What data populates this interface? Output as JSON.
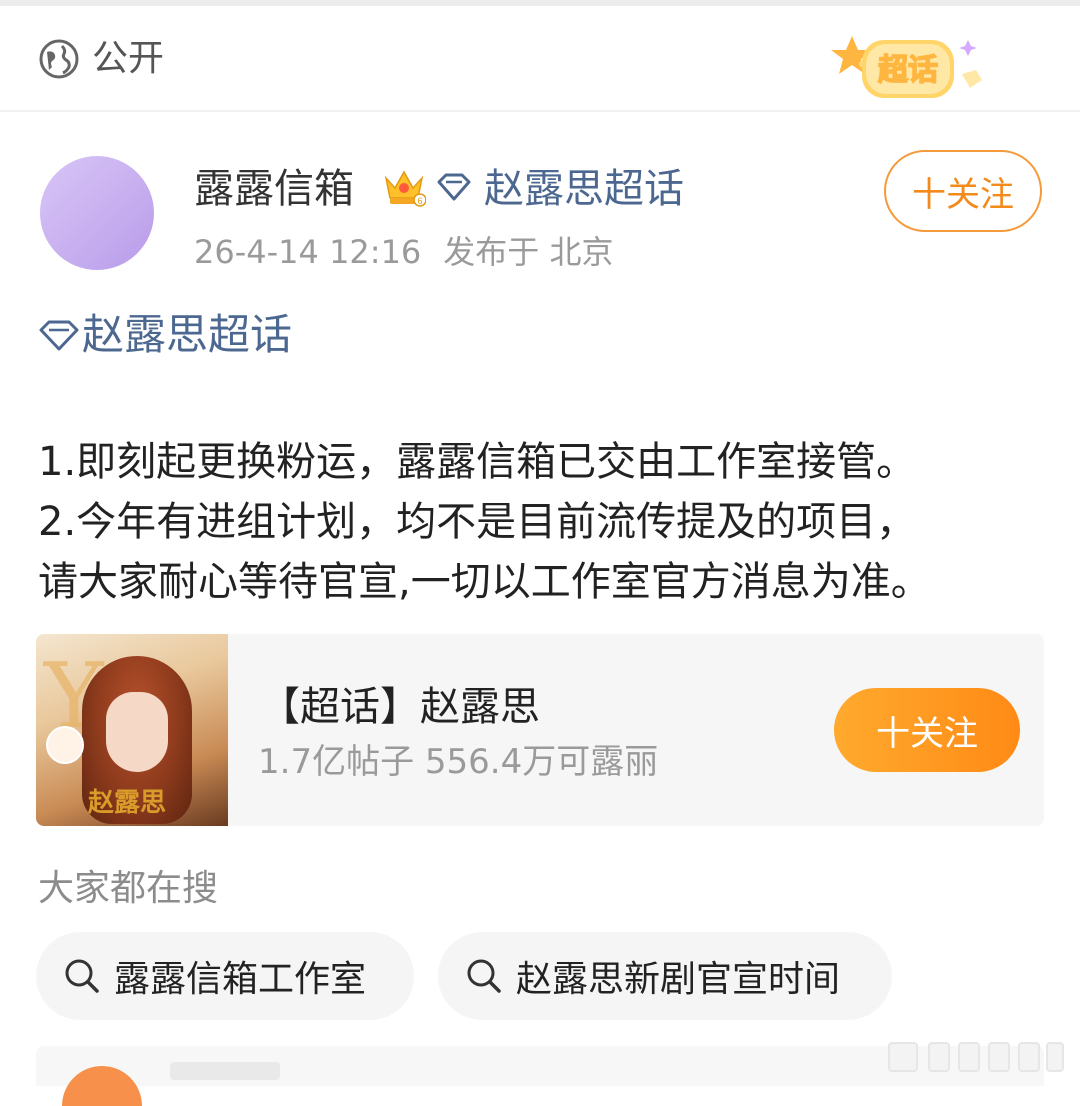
{
  "topbar": {
    "visibility_label": "公开",
    "badge_label": "超话"
  },
  "post": {
    "author_name": "露露信箱",
    "author_topic": "赵露思超话",
    "follow_label": "十关注",
    "timestamp": "26-4-14 12:16",
    "location": "发布于 北京",
    "topic_tag": "赵露思超话",
    "body_lines": [
      "1.即刻起更换粉运，露露信箱已交由工作室接管。",
      "2.今年有进组计划，均不是目前流传提及的项目，",
      "请大家耐心等待官宣,一切以工作室官方消息为准。"
    ]
  },
  "card": {
    "image_signature": "赵露思",
    "title": "【超话】赵露思",
    "stats": "1.7亿帖子 556.4万可露丽",
    "follow_label": "十关注"
  },
  "search": {
    "label": "大家都在搜",
    "chips": [
      "露露信箱工作室",
      "赵露思新剧官宣时间"
    ]
  },
  "colors": {
    "link": "#4d6890",
    "accent": "#ff8a15",
    "accent_border": "#f59a3a"
  }
}
